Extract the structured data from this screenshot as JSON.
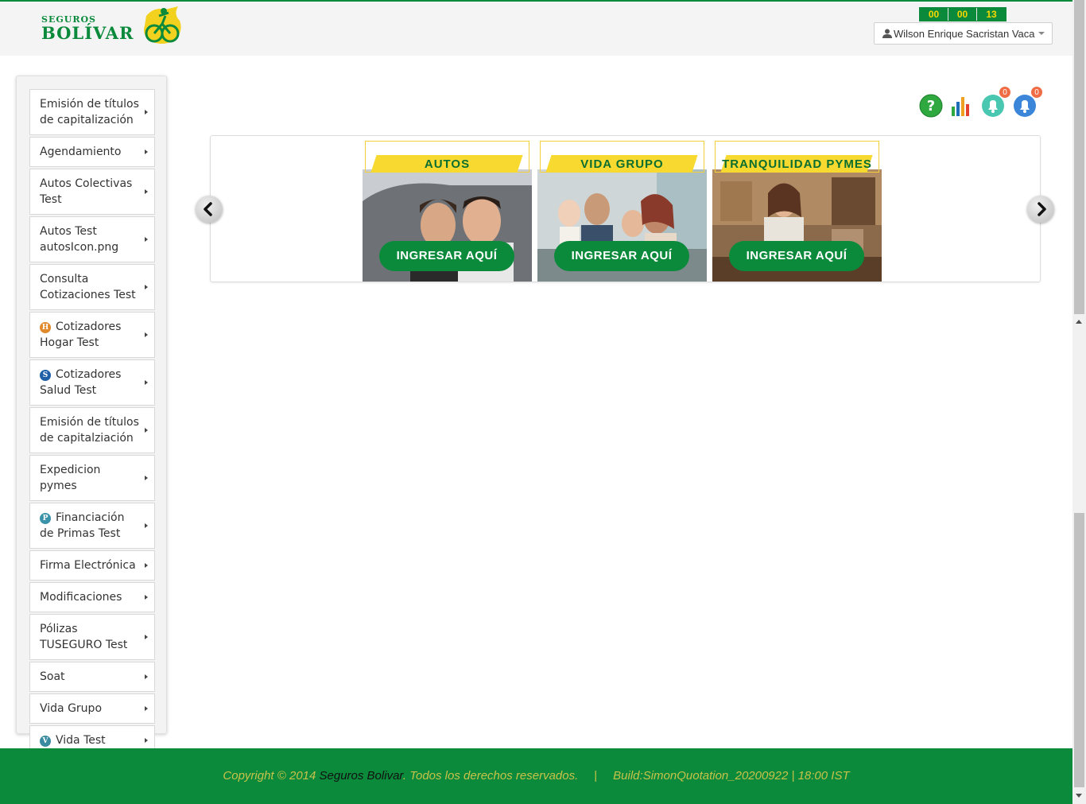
{
  "header": {
    "logo_small": "SEGUROS",
    "logo_big": "BOLÍVAR",
    "timer": [
      "00",
      "00",
      "13"
    ],
    "user_name": "Wilson Enrique Sacristan Vaca"
  },
  "sidebar": {
    "items": [
      {
        "label": "Emisión de títulos de capitalización",
        "badge": ""
      },
      {
        "label": "Agendamiento",
        "badge": ""
      },
      {
        "label": "Autos Colectivas Test",
        "badge": ""
      },
      {
        "label": "Autos Test autosIcon.png",
        "badge": ""
      },
      {
        "label": "Consulta Cotizaciones Test",
        "badge": ""
      },
      {
        "label": "Cotizadores Hogar Test",
        "badge": "H"
      },
      {
        "label": "Cotizadores Salud Test",
        "badge": "S"
      },
      {
        "label": "Emisión de títulos de capitalziación",
        "badge": ""
      },
      {
        "label": "Expedicion pymes",
        "badge": ""
      },
      {
        "label": "Financiación de Primas Test",
        "badge": "P"
      },
      {
        "label": "Firma Electrónica",
        "badge": ""
      },
      {
        "label": "Modificaciones",
        "badge": ""
      },
      {
        "label": "Pólizas TUSEGURO Test",
        "badge": ""
      },
      {
        "label": "Soat",
        "badge": ""
      },
      {
        "label": "Vida Grupo",
        "badge": ""
      },
      {
        "label": "Vida Test",
        "badge": "V"
      }
    ]
  },
  "top_icons": {
    "help_icon": "help-icon",
    "chart_icon": "bar-chart-icon",
    "notif1_count": "0",
    "notif2_count": "0"
  },
  "carousel": {
    "cards": [
      {
        "title": "AUTOS",
        "button": "INGRESAR AQUÍ"
      },
      {
        "title": "VIDA GRUPO",
        "button": "INGRESAR AQUÍ"
      },
      {
        "title": "TRANQUILIDAD PYMES",
        "button": "INGRESAR AQUÍ"
      }
    ],
    "prev": "‹",
    "next": "›"
  },
  "footer": {
    "copyright": "Copyright © 2014 ",
    "brand": "Seguros Bolivar",
    "rights": ". Todos los derechos reservados.",
    "separator": "|",
    "build": "Build:SimonQuotation_20200922 | 18:00 IST"
  },
  "colors": {
    "brand_green": "#0a8a3a",
    "timer_yellow": "#f6d800",
    "banner_yellow": "#f7d92f",
    "badge_orange": "#ef6c45"
  }
}
